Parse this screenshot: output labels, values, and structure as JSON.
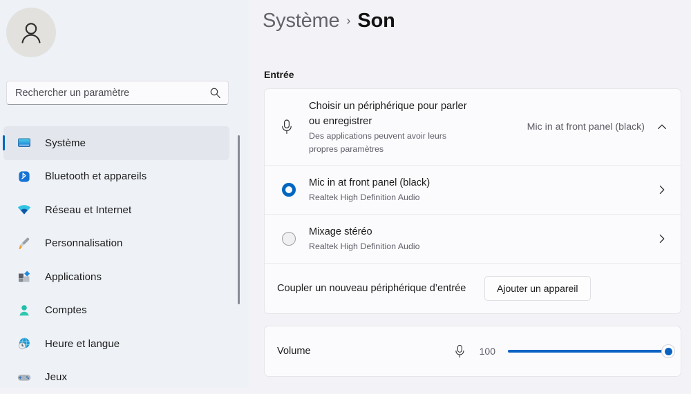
{
  "sidebar": {
    "avatar_icon": "person-avatar-icon",
    "search": {
      "placeholder": "Rechercher un paramètre",
      "value": "",
      "icon": "search-icon"
    },
    "items": [
      {
        "label": "Système",
        "icon": "monitor-icon",
        "selected": true
      },
      {
        "label": "Bluetooth et appareils",
        "icon": "bluetooth-icon",
        "selected": false
      },
      {
        "label": "Réseau et Internet",
        "icon": "wifi-icon",
        "selected": false
      },
      {
        "label": "Personnalisation",
        "icon": "paintbrush-icon",
        "selected": false
      },
      {
        "label": "Applications",
        "icon": "apps-icon",
        "selected": false
      },
      {
        "label": "Comptes",
        "icon": "account-icon",
        "selected": false
      },
      {
        "label": "Heure et langue",
        "icon": "clock-globe-icon",
        "selected": false
      },
      {
        "label": "Jeux",
        "icon": "gamepad-icon",
        "selected": false
      }
    ]
  },
  "header": {
    "parent": "Système",
    "separator": "›",
    "current": "Son"
  },
  "main": {
    "section_title": "Entrée",
    "device_chooser": {
      "icon": "microphone-icon",
      "title": "Choisir un périphérique pour parler ou enregistrer",
      "subtitle": "Des applications peuvent avoir leurs propres paramètres",
      "selected_value": "Mic in at front panel (black)",
      "expand_icon": "chevron-up-icon",
      "expanded": true
    },
    "devices": [
      {
        "name": "Mic in at front panel (black)",
        "driver": "Realtek High Definition Audio",
        "selected": true,
        "chevron": "chevron-right-icon"
      },
      {
        "name": "Mixage stéréo",
        "driver": "Realtek High Definition Audio",
        "selected": false,
        "chevron": "chevron-right-icon"
      }
    ],
    "pair": {
      "label": "Coupler un nouveau périphérique d’entrée",
      "button": "Ajouter un appareil"
    },
    "volume": {
      "label": "Volume",
      "icon": "microphone-icon",
      "value": "100",
      "percent": 100
    }
  },
  "colors": {
    "accent": "#0067c0",
    "slider": "#0a63c3",
    "page_bg": "#f3f3f7",
    "sidebar_bg": "#eef1f6",
    "card_bg": "#fbfbfd"
  }
}
